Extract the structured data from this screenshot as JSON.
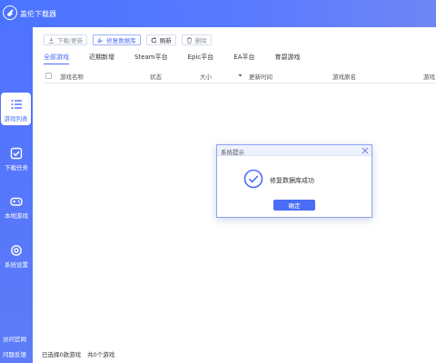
{
  "app": {
    "title": "盖伦下载器"
  },
  "sidebar": {
    "items": [
      {
        "label": "游戏列表",
        "icon": "list-icon"
      },
      {
        "label": "下载任务",
        "icon": "download-task-icon"
      },
      {
        "label": "本地游戏",
        "icon": "gamepad-icon"
      },
      {
        "label": "系统设置",
        "icon": "gear-icon"
      }
    ],
    "links": [
      "访问官网",
      "问题反馈"
    ]
  },
  "toolbar": {
    "download_update": "下载/更新",
    "repair_db": "修复数据库",
    "refresh": "刷新",
    "delete": "删除"
  },
  "tabs": [
    "全部游戏",
    "近期新增",
    "Steam平台",
    "Epic平台",
    "EA平台",
    "育碧游戏"
  ],
  "table": {
    "headers": [
      "游戏名称",
      "状态",
      "大小",
      "更新时间",
      "游戏原名",
      "游戏"
    ]
  },
  "footer": {
    "selected": "已选择0款游戏",
    "total": "共0个游戏"
  },
  "dialog": {
    "title": "系统提示",
    "message": "修复数据库成功",
    "ok": "确定"
  },
  "colors": {
    "accent": "#4a6cf7",
    "sidebar": "#5575fb"
  }
}
